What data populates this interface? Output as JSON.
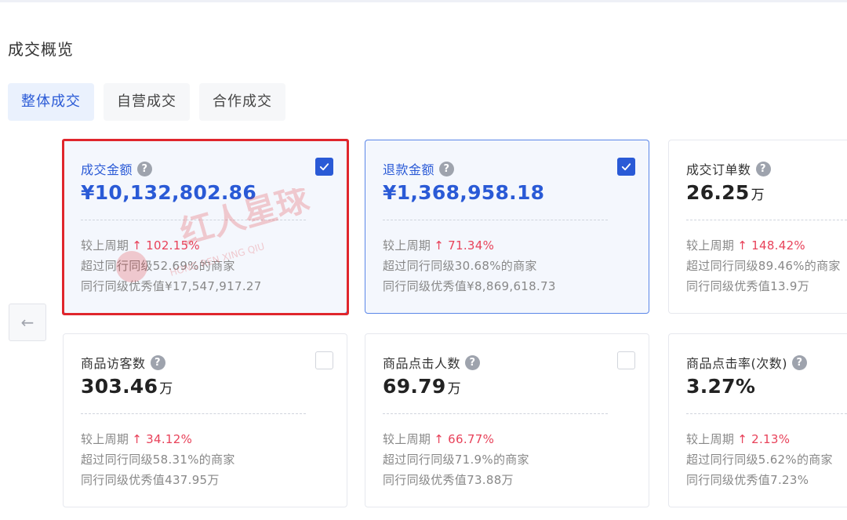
{
  "section": {
    "title": "成交概览"
  },
  "tabs": [
    {
      "label": "整体成交"
    },
    {
      "label": "自营成交"
    },
    {
      "label": "合作成交"
    }
  ],
  "colors": {
    "accent": "#2a5ad6",
    "up_trend": "#e8425a",
    "highlight": "#e0262c"
  },
  "cards": [
    {
      "title": "成交金额",
      "value": "¥10,132,802.86",
      "unit": "",
      "compare_label": "较上周期",
      "trend": "↑ 102.15%",
      "beat": "超过同行同级52.69%的商家",
      "best": "同行同级优秀值¥17,547,917.27",
      "checked": true
    },
    {
      "title": "退款金额",
      "value": "¥1,368,958.18",
      "unit": "",
      "compare_label": "较上周期",
      "trend": "↑ 71.34%",
      "beat": "超过同行同级30.68%的商家",
      "best": "同行同级优秀值¥8,869,618.73",
      "checked": true
    },
    {
      "title": "成交订单数",
      "value": "26.25",
      "unit": "万",
      "compare_label": "较上周期",
      "trend": "↑ 148.42%",
      "beat": "超过同行同级89.46%的商家",
      "best": "同行同级优秀值13.9万",
      "checked": false
    },
    {
      "title": "商品访客数",
      "value": "303.46",
      "unit": "万",
      "compare_label": "较上周期",
      "trend": "↑ 34.12%",
      "beat": "超过同行同级58.31%的商家",
      "best": "同行同级优秀值437.95万",
      "checked": false
    },
    {
      "title": "商品点击人数",
      "value": "69.79",
      "unit": "万",
      "compare_label": "较上周期",
      "trend": "↑ 66.77%",
      "beat": "超过同行同级71.9%的商家",
      "best": "同行同级优秀值73.88万",
      "checked": false
    },
    {
      "title": "商品点击率(次数)",
      "value": "3.27%",
      "unit": "",
      "compare_label": "较上周期",
      "trend": "↑ 2.13%",
      "beat": "超过同行同级5.62%的商家",
      "best": "同行同级优秀值7.23%",
      "checked": false
    }
  ],
  "nav": {
    "prev_icon": "arrow-left-icon",
    "prev_glyph": "←"
  },
  "watermark": {
    "text": "红人星球",
    "subtext": "HONG REN XING QIU"
  }
}
